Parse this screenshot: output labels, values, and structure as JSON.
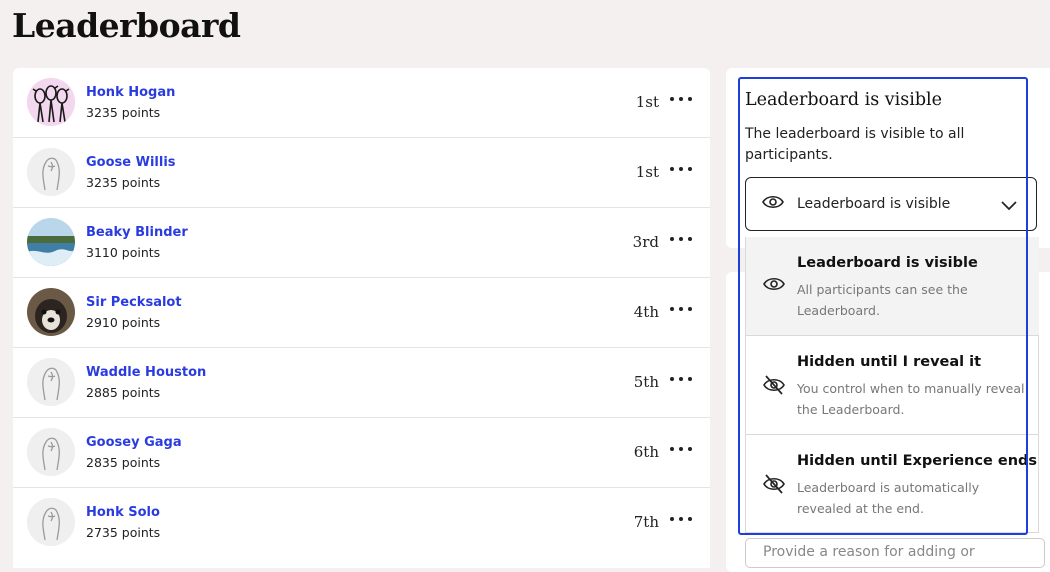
{
  "page": {
    "title": "Leaderboard"
  },
  "participants": [
    {
      "name": "Honk Hogan",
      "points": "3235 points",
      "rank": "1st",
      "avatar": "geese-drawing"
    },
    {
      "name": "Goose Willis",
      "points": "3235 points",
      "rank": "1st",
      "avatar": "default-goose"
    },
    {
      "name": "Beaky Blinder",
      "points": "3110 points",
      "rank": "3rd",
      "avatar": "ocean-photo"
    },
    {
      "name": "Sir Pecksalot",
      "points": "2910 points",
      "rank": "4th",
      "avatar": "dog-photo"
    },
    {
      "name": "Waddle Houston",
      "points": "2885 points",
      "rank": "5th",
      "avatar": "default-goose"
    },
    {
      "name": "Goosey Gaga",
      "points": "2835 points",
      "rank": "6th",
      "avatar": "default-goose"
    },
    {
      "name": "Honk Solo",
      "points": "2735 points",
      "rank": "7th",
      "avatar": "default-goose"
    }
  ],
  "visibility": {
    "title": "Leaderboard is visible",
    "description": "The leaderboard is visible to all participants.",
    "selected": "Leaderboard is visible",
    "options": [
      {
        "title": "Leaderboard is visible",
        "description": "All participants can see the Leaderboard.",
        "icon": "eye-icon"
      },
      {
        "title": "Hidden until I reveal it",
        "description": "You control when to manually reveal the Leaderboard.",
        "icon": "eye-off-icon"
      },
      {
        "title": "Hidden until Experience ends",
        "description": "Leaderboard is automatically revealed at the end.",
        "icon": "eye-off-icon"
      }
    ]
  },
  "reason": {
    "placeholder": "Provide a reason for adding or"
  },
  "colors": {
    "accent": "#2a3ce0",
    "focus": "#1d3fdc",
    "background": "#f4f0ef"
  }
}
